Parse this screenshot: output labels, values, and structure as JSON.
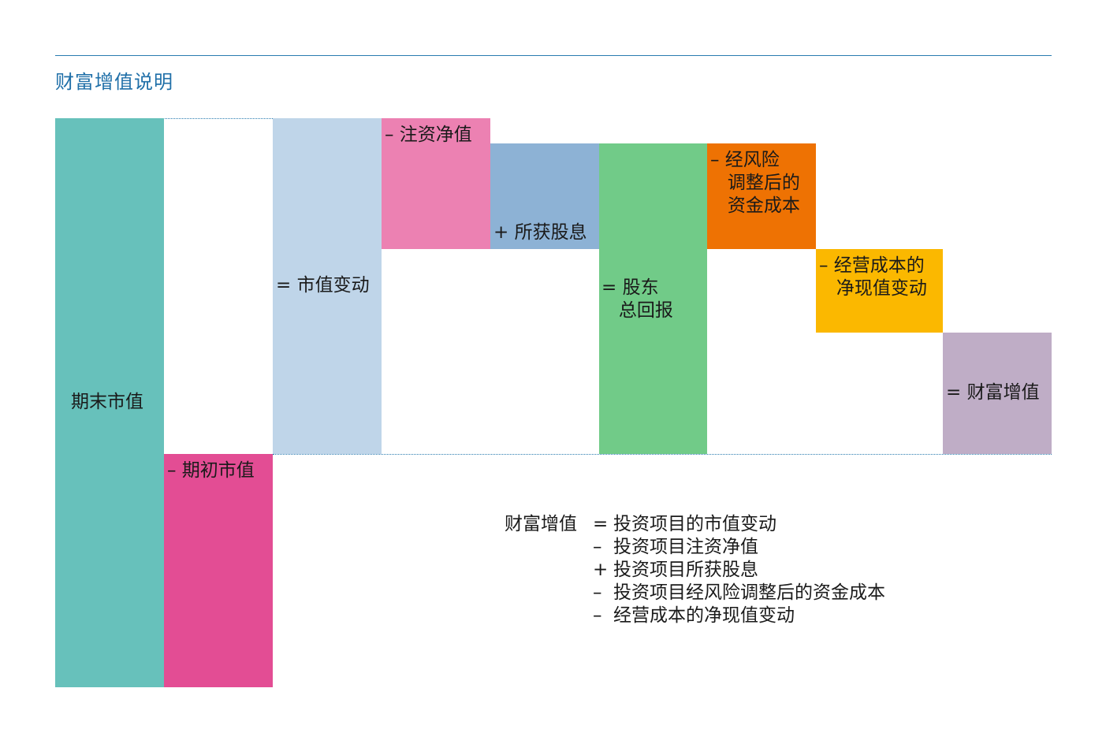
{
  "title": "财富增值说明",
  "colors": {
    "rule": "#2a7cb0",
    "title": "#1f6fa8",
    "ending_value": "#67c1bb",
    "beginning_value": "#e34d94",
    "market_change": "#bfd5e9",
    "capital_injection": "#ec81b2",
    "dividends": "#8db2d5",
    "tsr": "#71cb88",
    "risk_adjusted_cost": "#ee7203",
    "operating_cost": "#fbb800",
    "wealth_added": "#bfadc6"
  },
  "blocks": {
    "ending_value": {
      "label": "期末市值"
    },
    "beginning_value": {
      "label": "– 期初市值"
    },
    "market_change": {
      "label": "= 市值变动"
    },
    "capital_injection": {
      "label": "– 注资净值"
    },
    "dividends": {
      "label": "+ 所获股息"
    },
    "tsr": {
      "label": "= 股东\n   总回报"
    },
    "risk_adjusted_cost": {
      "label": "– 经风险\n   调整后的\n   资金成本"
    },
    "operating_cost": {
      "label": "– 经营成本的\n   净现值变动"
    },
    "wealth_added": {
      "label": "= 财富增值"
    }
  },
  "formula": {
    "lhs": "财富增值",
    "rows": [
      {
        "op": "=",
        "term": "投资项目的市值变动"
      },
      {
        "op": "–",
        "term": "投资项目注资净值"
      },
      {
        "op": "+",
        "term": "投资项目所获股息"
      },
      {
        "op": "–",
        "term": "投资项目经风险调整后的资金成本"
      },
      {
        "op": "–",
        "term": "经营成本的净现值变动"
      }
    ]
  }
}
